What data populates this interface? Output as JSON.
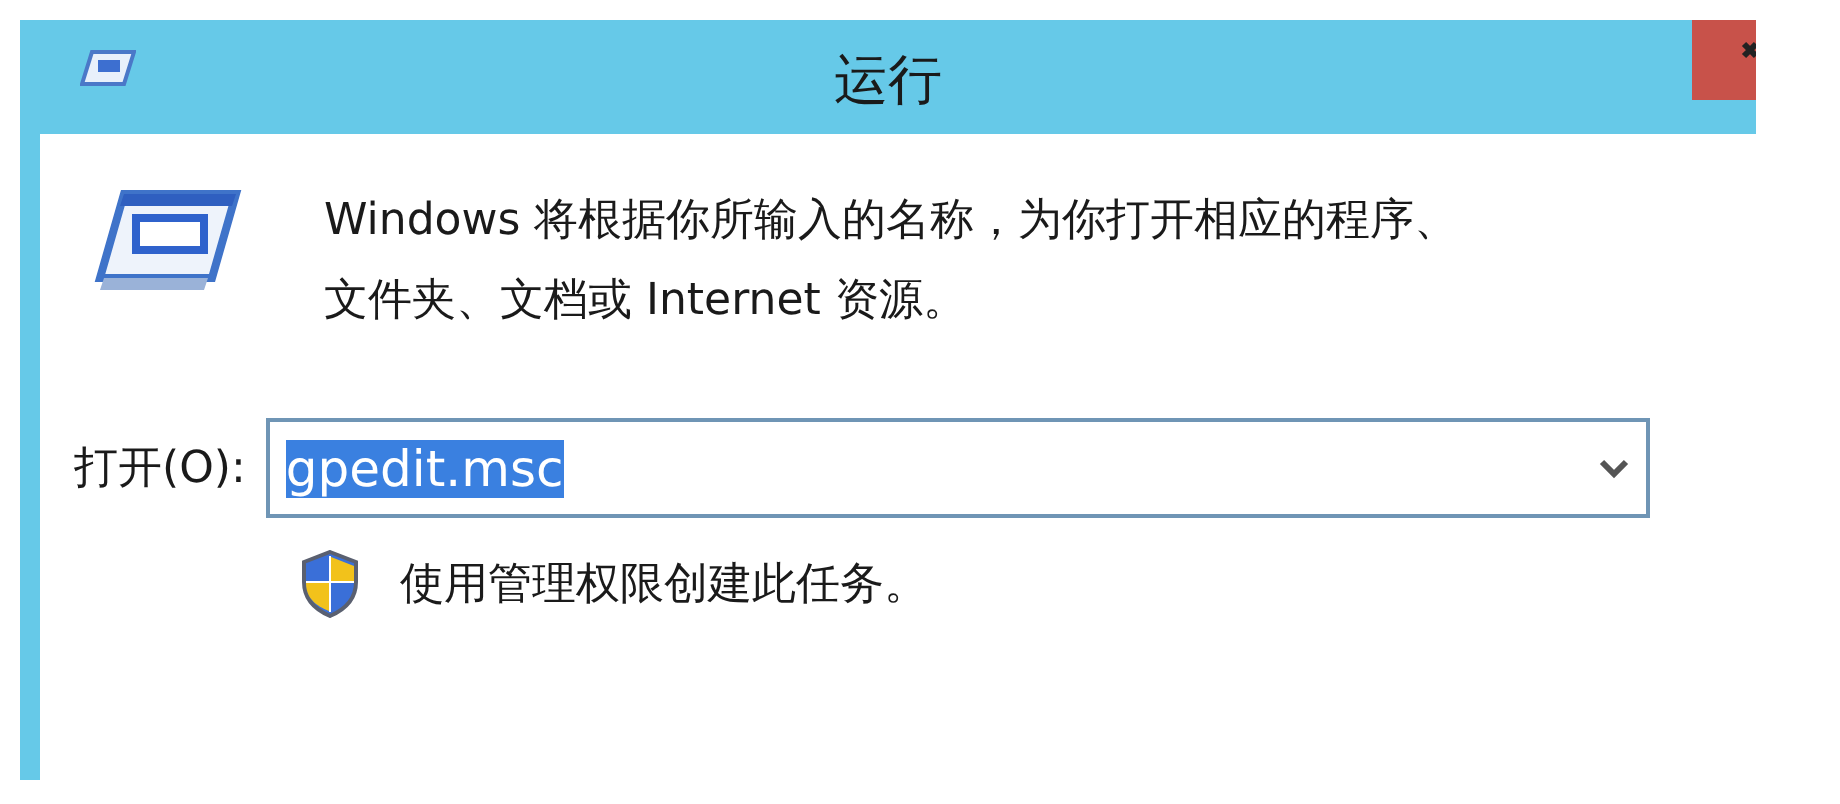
{
  "window": {
    "title": "运行"
  },
  "description_lines": [
    "Windows 将根据你所输入的名称，为你打开相应的程序、",
    "文件夹、文档或 Internet 资源。"
  ],
  "open_field": {
    "label": "打开(O):",
    "value": "gpedit.msc",
    "selected": true
  },
  "admin_note": {
    "text": "使用管理权限创建此任务。"
  }
}
